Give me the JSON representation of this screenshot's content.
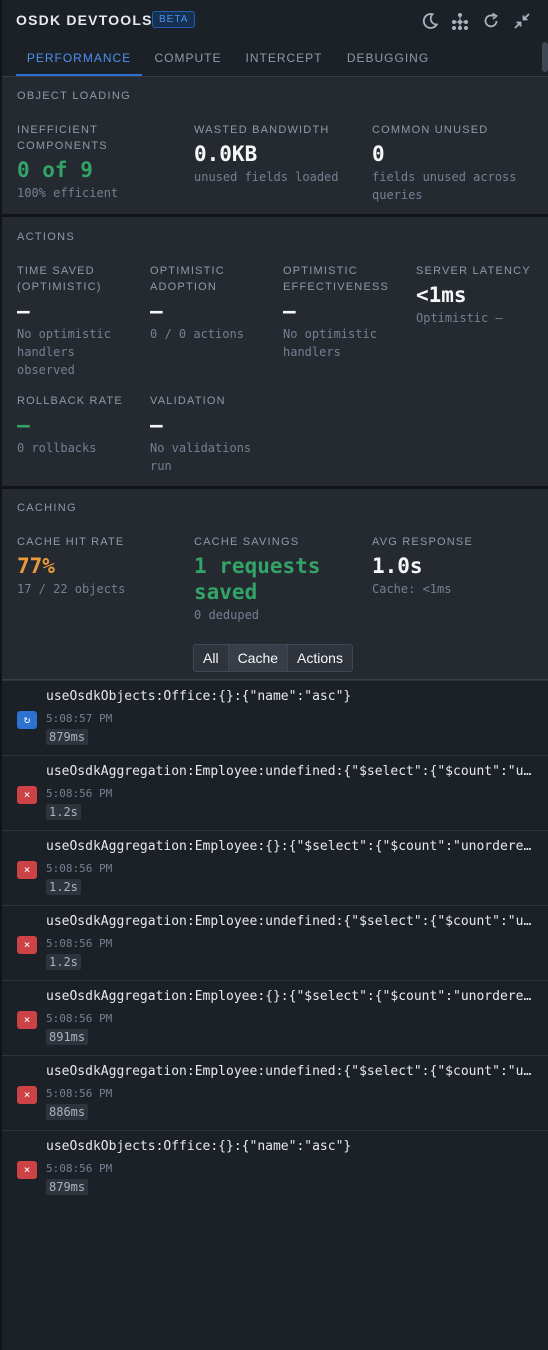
{
  "header": {
    "title": "OSDK DEVTOOLS",
    "badge": "BETA",
    "icons": [
      "moon-icon",
      "network-icon",
      "refresh-icon",
      "minimize-icon"
    ]
  },
  "tabs": [
    {
      "label": "PERFORMANCE",
      "active": true
    },
    {
      "label": "COMPUTE",
      "active": false
    },
    {
      "label": "INTERCEPT",
      "active": false
    },
    {
      "label": "DEBUGGING",
      "active": false
    }
  ],
  "object_loading": {
    "title": "OBJECT LOADING",
    "inefficient": {
      "label": "INEFFICIENT COMPONENTS",
      "value": "0 of 9",
      "sub": "100% efficient"
    },
    "wasted": {
      "label": "WASTED BANDWIDTH",
      "value": "0.0KB",
      "sub": "unused fields loaded"
    },
    "unused": {
      "label": "COMMON UNUSED",
      "value": "0",
      "sub": "fields unused across queries"
    }
  },
  "actions": {
    "title": "ACTIONS",
    "time_saved": {
      "label": "TIME SAVED (OPTIMISTIC)",
      "value": "—",
      "sub": "No optimistic handlers observed"
    },
    "adoption": {
      "label": "OPTIMISTIC ADOPTION",
      "value": "—",
      "sub": "0 / 0 actions"
    },
    "effectiveness": {
      "label": "OPTIMISTIC EFFECTIVENESS",
      "value": "—",
      "sub": "No optimistic handlers"
    },
    "latency": {
      "label": "SERVER LATENCY",
      "value": "<1ms",
      "sub": "Optimistic —"
    },
    "rollback": {
      "label": "ROLLBACK RATE",
      "value": "—",
      "sub": "0 rollbacks"
    },
    "validation": {
      "label": "VALIDATION",
      "value": "—",
      "sub": "No validations run"
    }
  },
  "caching": {
    "title": "CACHING",
    "hit_rate": {
      "label": "CACHE HIT RATE",
      "value": "77%",
      "sub": "17 / 22 objects"
    },
    "savings": {
      "label": "CACHE SAVINGS",
      "value": "1 requests saved",
      "sub": "0 deduped"
    },
    "avg": {
      "label": "AVG RESPONSE",
      "value": "1.0s",
      "sub": "Cache: <1ms"
    }
  },
  "filters": {
    "all": "All",
    "cache": "Cache",
    "actions": "Actions",
    "selected": "Cache"
  },
  "requests": [
    {
      "key": "useOsdkObjects:Office:{}:{\"name\":\"asc\"}",
      "time": "5:08:57 PM",
      "duration": "879ms",
      "status": "cache-icon"
    },
    {
      "key": "useOsdkAggregation:Employee:undefined:{\"$select\":{\"$count\":\"unordered\"}}",
      "time": "5:08:56 PM",
      "duration": "1.2s",
      "status": "error-icon"
    },
    {
      "key": "useOsdkAggregation:Employee:{}:{\"$select\":{\"$count\":\"unordered\"}}",
      "time": "5:08:56 PM",
      "duration": "1.2s",
      "status": "error-icon"
    },
    {
      "key": "useOsdkAggregation:Employee:undefined:{\"$select\":{\"$count\":\"unordered\"}}",
      "time": "5:08:56 PM",
      "duration": "1.2s",
      "status": "error-icon"
    },
    {
      "key": "useOsdkAggregation:Employee:{}:{\"$select\":{\"$count\":\"unordered\"}}",
      "time": "5:08:56 PM",
      "duration": "891ms",
      "status": "error-icon"
    },
    {
      "key": "useOsdkAggregation:Employee:undefined:{\"$select\":{\"$count\":\"unordered\"}}",
      "time": "5:08:56 PM",
      "duration": "886ms",
      "status": "error-icon"
    },
    {
      "key": "useOsdkObjects:Office:{}:{\"name\":\"asc\"}",
      "time": "5:08:56 PM",
      "duration": "879ms",
      "status": "error-icon"
    }
  ]
}
